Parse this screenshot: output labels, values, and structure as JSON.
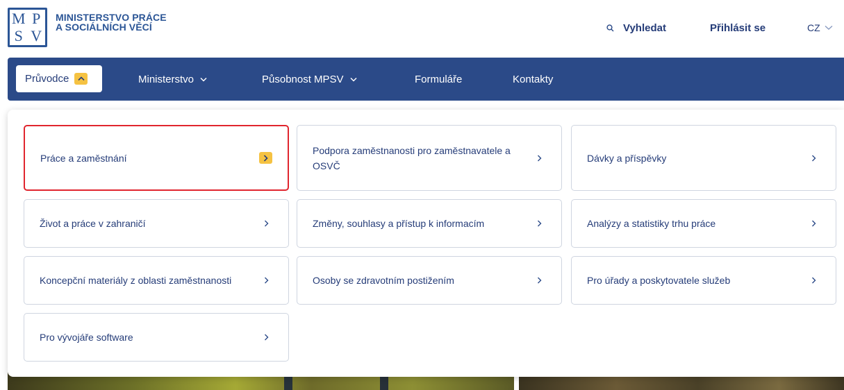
{
  "header": {
    "logo_letters": [
      "M",
      "P",
      "S",
      "V"
    ],
    "org_name_line1": "MINISTERSTVO PRÁCE",
    "org_name_line2": "A SOCIÁLNÍCH VĚCÍ",
    "search_label": "Vyhledat",
    "login_label": "Přihlásit se",
    "language": "CZ"
  },
  "nav": {
    "items": [
      {
        "label": "Průvodce"
      },
      {
        "label": "Ministerstvo"
      },
      {
        "label": "Působnost MPSV"
      },
      {
        "label": "Formuláře"
      },
      {
        "label": "Kontakty"
      }
    ]
  },
  "menu": {
    "cards": [
      {
        "label": "Práce a zaměstnání"
      },
      {
        "label": "Podpora zaměstnanosti pro zaměstnavatele a OSVČ"
      },
      {
        "label": "Dávky a příspěvky"
      },
      {
        "label": "Život a práce v zahraničí"
      },
      {
        "label": "Změny, souhlasy a přístup k informacím"
      },
      {
        "label": "Analýzy a statistiky trhu práce"
      },
      {
        "label": "Koncepční materiály z oblasti zaměstnanosti"
      },
      {
        "label": "Osoby se zdravotním postižením"
      },
      {
        "label": "Pro úřady a poskytovatele služeb"
      },
      {
        "label": "Pro vývojáře software"
      }
    ]
  },
  "colors": {
    "brand_blue": "#2b4a88",
    "text_blue": "#253c78",
    "accent_yellow": "#f5c242",
    "highlight_red": "#e0252e"
  }
}
